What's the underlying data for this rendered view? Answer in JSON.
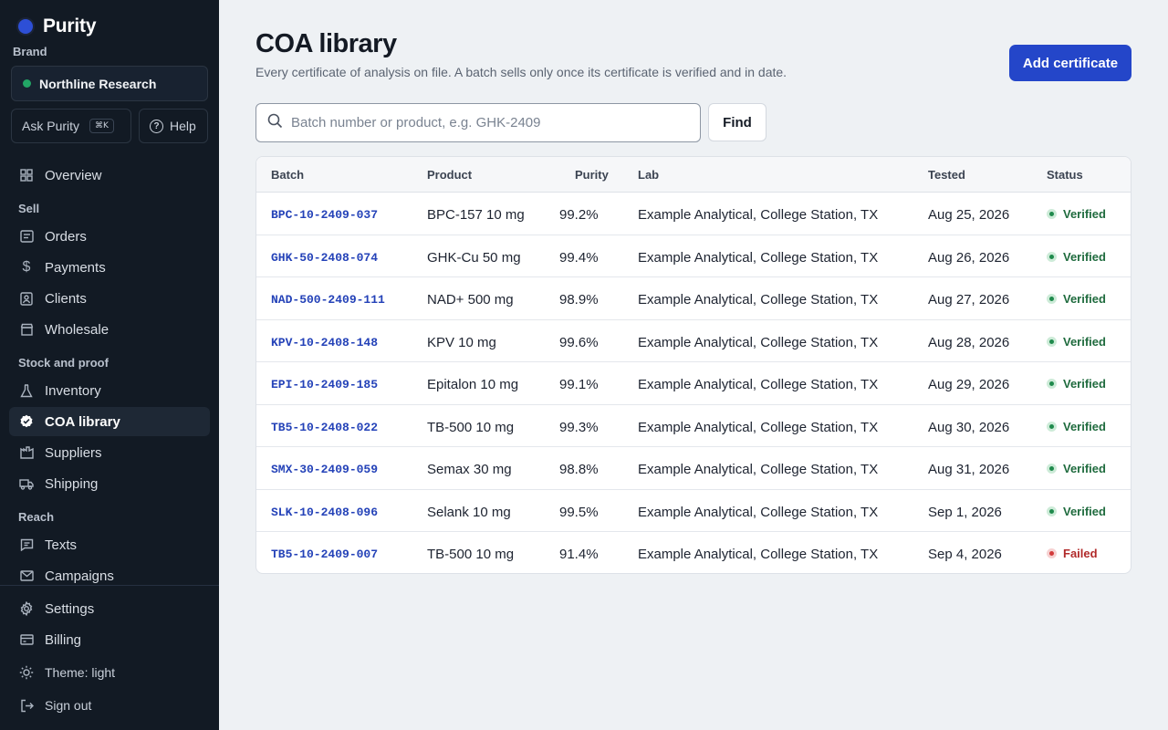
{
  "app": {
    "name": "Purity"
  },
  "brand": {
    "label": "Brand",
    "name": "Northline Research"
  },
  "quick": {
    "ask_label": "Ask Purity",
    "ask_shortcut": "⌘K",
    "help_label": "Help"
  },
  "nav": {
    "overview": "Overview",
    "sell_heading": "Sell",
    "sell": [
      "Orders",
      "Payments",
      "Clients",
      "Wholesale"
    ],
    "stock_heading": "Stock and proof",
    "stock": [
      "Inventory",
      "COA library",
      "Suppliers",
      "Shipping"
    ],
    "reach_heading": "Reach",
    "reach": [
      "Texts",
      "Campaigns"
    ],
    "footer": [
      "Settings",
      "Billing"
    ],
    "theme": "Theme: light",
    "signout": "Sign out"
  },
  "page": {
    "title": "COA library",
    "subtitle": "Every certificate of analysis on file. A batch sells only once its certificate is verified and in date.",
    "add_button": "Add certificate"
  },
  "search": {
    "placeholder": "Batch number or product, e.g. GHK-2409",
    "button": "Find"
  },
  "table": {
    "columns": [
      "Batch",
      "Product",
      "Purity",
      "Lab",
      "Tested",
      "Status"
    ],
    "rows": [
      {
        "batch": "BPC-10-2409-037",
        "product": "BPC-157 10 mg",
        "purity": "99.2%",
        "lab": "Example Analytical, College Station, TX",
        "tested": "Aug 25, 2026",
        "status": "Verified"
      },
      {
        "batch": "GHK-50-2408-074",
        "product": "GHK-Cu 50 mg",
        "purity": "99.4%",
        "lab": "Example Analytical, College Station, TX",
        "tested": "Aug 26, 2026",
        "status": "Verified"
      },
      {
        "batch": "NAD-500-2409-111",
        "product": "NAD+ 500 mg",
        "purity": "98.9%",
        "lab": "Example Analytical, College Station, TX",
        "tested": "Aug 27, 2026",
        "status": "Verified"
      },
      {
        "batch": "KPV-10-2408-148",
        "product": "KPV 10 mg",
        "purity": "99.6%",
        "lab": "Example Analytical, College Station, TX",
        "tested": "Aug 28, 2026",
        "status": "Verified"
      },
      {
        "batch": "EPI-10-2409-185",
        "product": "Epitalon 10 mg",
        "purity": "99.1%",
        "lab": "Example Analytical, College Station, TX",
        "tested": "Aug 29, 2026",
        "status": "Verified"
      },
      {
        "batch": "TB5-10-2408-022",
        "product": "TB-500 10 mg",
        "purity": "99.3%",
        "lab": "Example Analytical, College Station, TX",
        "tested": "Aug 30, 2026",
        "status": "Verified"
      },
      {
        "batch": "SMX-30-2409-059",
        "product": "Semax 30 mg",
        "purity": "98.8%",
        "lab": "Example Analytical, College Station, TX",
        "tested": "Aug 31, 2026",
        "status": "Verified"
      },
      {
        "batch": "SLK-10-2408-096",
        "product": "Selank 10 mg",
        "purity": "99.5%",
        "lab": "Example Analytical, College Station, TX",
        "tested": "Sep 1, 2026",
        "status": "Verified"
      },
      {
        "batch": "TB5-10-2409-007",
        "product": "TB-500 10 mg",
        "purity": "91.4%",
        "lab": "Example Analytical, College Station, TX",
        "tested": "Sep 4, 2026",
        "status": "Failed"
      }
    ]
  },
  "colors": {
    "accent": "#2446c9",
    "sidebar": "#121a24",
    "verified": "#1f8a4c",
    "failed": "#d23b3b"
  }
}
